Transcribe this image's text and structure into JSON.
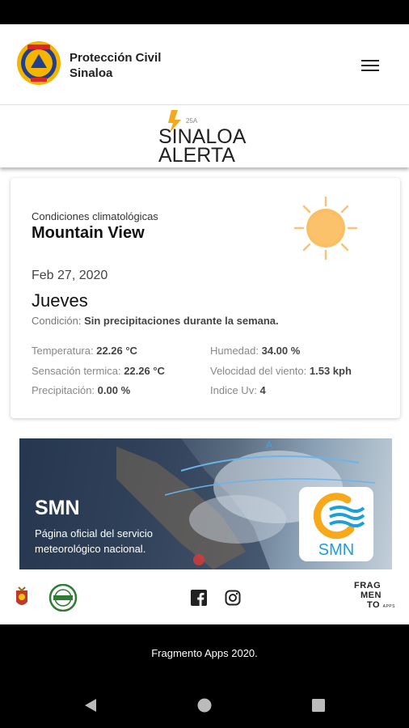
{
  "header": {
    "title_line1": "Protección Civil",
    "title_line2": "Sinaloa",
    "logo_icon": "proteccion-civil-logo-icon",
    "menu_icon": "hamburger-menu-icon"
  },
  "brand": {
    "logo_text_top": "SINALOA",
    "logo_text_bottom": "ALERTA",
    "logo_small": "25A"
  },
  "weather": {
    "label": "Condiciones climatológicas",
    "city": "Mountain View",
    "date": "Feb 27, 2020",
    "day": "Jueves",
    "condition_label": "Condición:",
    "condition_value": "Sin precipitaciones durante la semana.",
    "icon": "sun-icon",
    "stats": {
      "temperature_label": "Temperatura:",
      "temperature_value": "22.26 °C",
      "feels_label": "Sensación termica:",
      "feels_value": "22.26 °C",
      "precip_label": "Precipitación:",
      "precip_value": "0.00 %",
      "humidity_label": "Humedad:",
      "humidity_value": "34.00 %",
      "wind_label": "Velocidad del viento:",
      "wind_value": "1.53 kph",
      "uv_label": "Indice Uv:",
      "uv_value": "4"
    },
    "colors": {
      "sun": "#f9b64f",
      "sun_rays": "#f7c27a"
    }
  },
  "smn": {
    "title": "SMN",
    "description": "Página oficial del servicio meteorológico nacional.",
    "logo_text": "SMN",
    "colors": {
      "logo_orange": "#f7a81b",
      "logo_blue": "#1d9fd8"
    }
  },
  "footer": {
    "icons": [
      "sinaloa-coat-of-arms-icon",
      "seal-icon",
      "facebook-icon",
      "instagram-icon"
    ],
    "fragmento_line1": "FRAG",
    "fragmento_line2": "MEN",
    "fragmento_line3": "TO",
    "fragmento_apps": "APPS",
    "copyright": "Fragmento Apps 2020."
  },
  "nav": {
    "back_icon": "back-triangle-icon",
    "home_icon": "home-circle-icon",
    "recents_icon": "recents-square-icon"
  }
}
